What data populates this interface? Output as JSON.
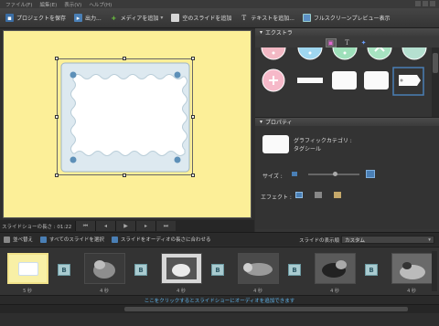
{
  "menu": [
    "ファイル(F)",
    "編集(E)",
    "表示(V)",
    "ヘルプ(H)"
  ],
  "toolbar": {
    "save": "プロジェクトを保存",
    "output": "出力...",
    "add_media": "メディアを追加",
    "add_blank": "空のスライドを追加",
    "add_text": "テキストを追加...",
    "fullscreen": "フルスクリーンプレビュー表示"
  },
  "transport": {
    "duration_label": "スライドショーの長さ : 01:22"
  },
  "extras": {
    "title": "エクストラ"
  },
  "properties": {
    "title": "プロパティ",
    "category_label": "グラフィックカテゴリ :",
    "category_value": "タグシール",
    "size_label": "サイズ :",
    "effect_label": "エフェクト :",
    "size_level": 0.52
  },
  "options": {
    "shuffle": "並べ替え",
    "select_all": "すべてのスライドを選択",
    "fit_audio": "スライドをオーディオの長さに合わせる",
    "display_label": "スライドの表示順 :",
    "display_value": "カスタム"
  },
  "filmstrip": {
    "durations": [
      "5 秒",
      "4 秒",
      "4 秒",
      "4 秒",
      "4 秒",
      "4 秒"
    ]
  },
  "audio_hint": "ここをクリックするとスライドショーにオーディオを追加できます",
  "colors": {
    "preview_bg": "#fcef98",
    "accent": "#4a7fb5",
    "transition": "#a9cbd0"
  }
}
